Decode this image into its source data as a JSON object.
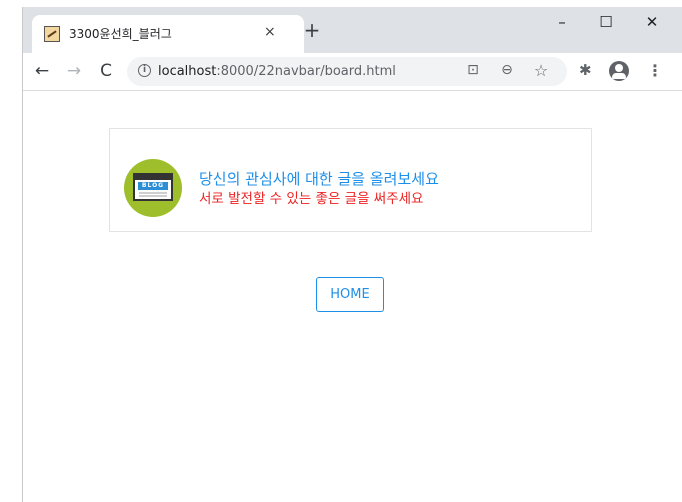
{
  "browser": {
    "tab_title": "3300윤선희_블러그",
    "tab_close": "×",
    "new_tab": "+",
    "url_host": "localhost",
    "url_path": ":8000/22navbar/board.html",
    "window_controls": {
      "minimize": "–",
      "maximize": "☐",
      "close": "✕"
    }
  },
  "icons": {
    "back": "←",
    "forward": "→",
    "reload": "C",
    "info": "i",
    "translate": "⊡",
    "zoom": "⊖",
    "star": "☆",
    "extensions": "✱",
    "menu": "⋮"
  },
  "banner": {
    "logo_word": "BLOG",
    "heading": "당신의 관심사에 대한 글을 올려보세요",
    "subheading": "서로 발전할 수 있는 좋은 글을 써주세요"
  },
  "home_button": {
    "label": "HOME"
  },
  "colors": {
    "accent": "#1e8fe8",
    "subheading": "#ee2222",
    "chrome_bg": "#dee1e6"
  }
}
